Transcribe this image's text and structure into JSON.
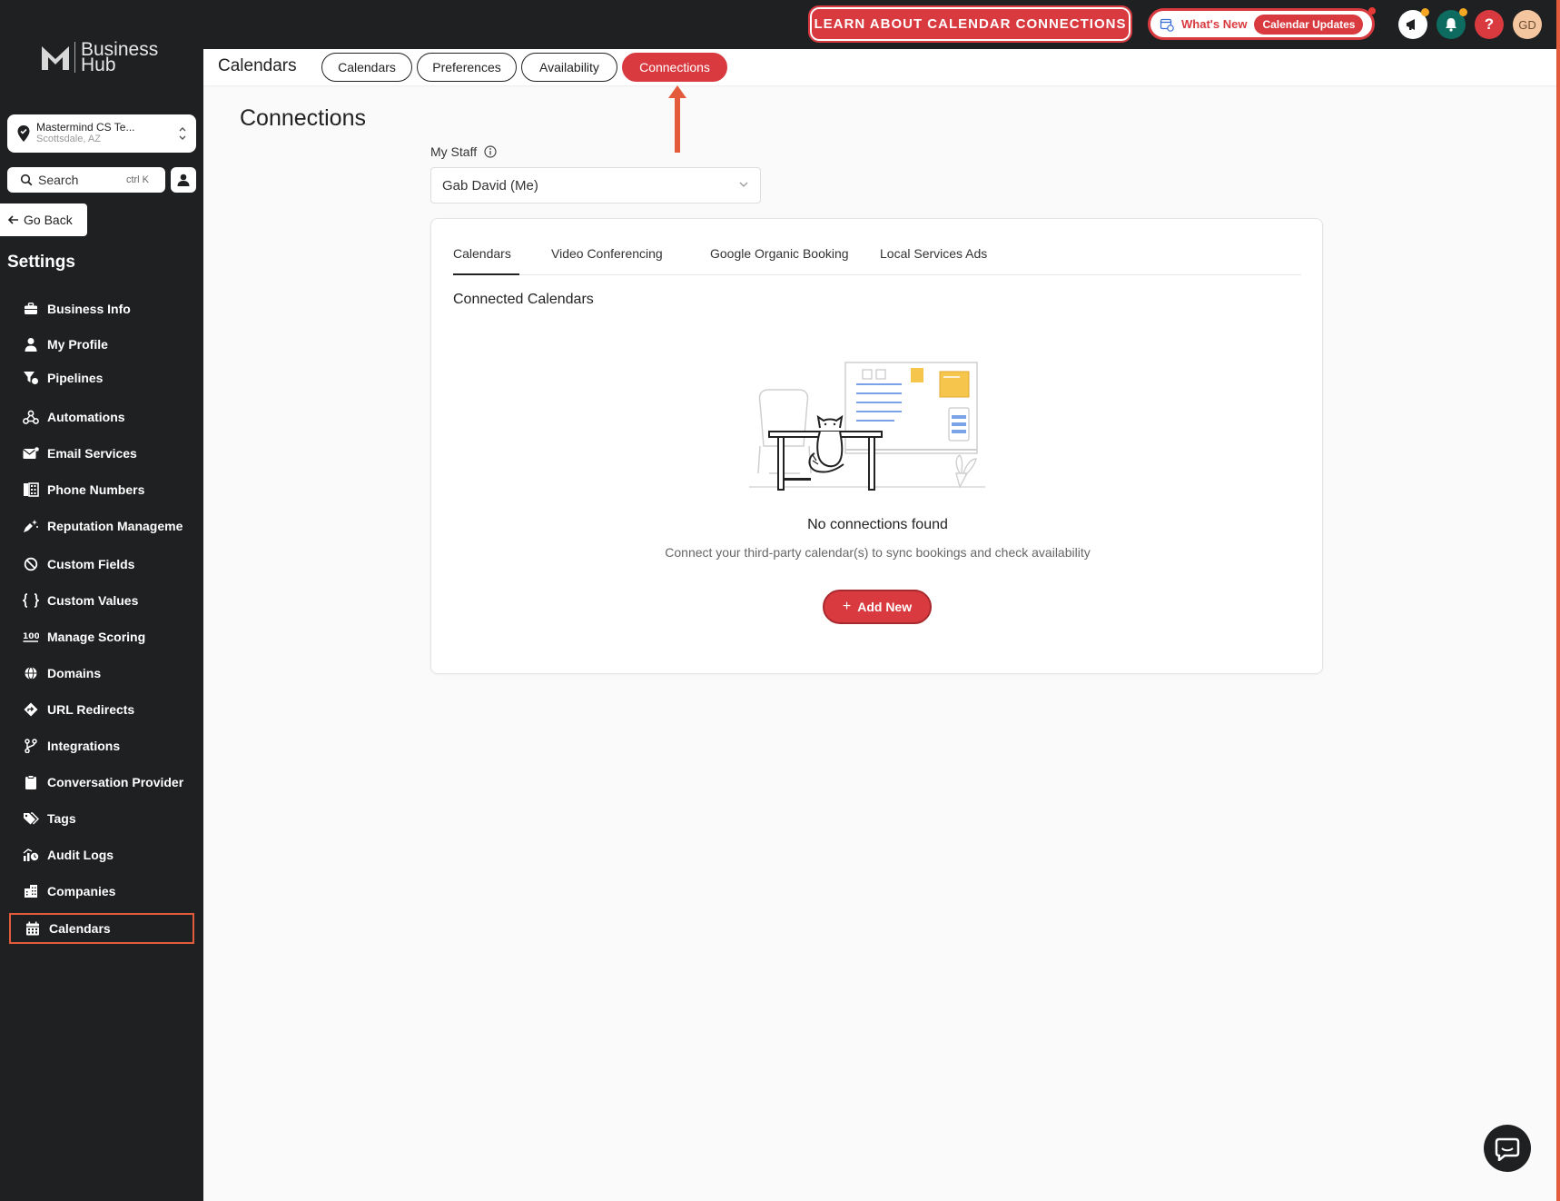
{
  "topbar": {
    "learn_button": "LEARN ABOUT CALENDAR CONNECTIONS",
    "whats_new_label": "What's New",
    "calendar_updates_label": "Calendar Updates",
    "avatar_initials": "GD",
    "help_label": "?"
  },
  "sidebar": {
    "logo_line1": "Business",
    "logo_line2": "Hub",
    "location_name": "Mastermind CS Te...",
    "location_sub": "Scottsdale, AZ",
    "search_label": "Search",
    "search_shortcut": "ctrl K",
    "go_back": "Go Back",
    "settings_title": "Settings",
    "items": [
      {
        "label": "Business Info",
        "icon": "briefcase-icon"
      },
      {
        "label": "My Profile",
        "icon": "user-icon"
      },
      {
        "label": "Pipelines",
        "icon": "funnel-icon"
      },
      {
        "label": "Automations",
        "icon": "automation-icon"
      },
      {
        "label": "Email Services",
        "icon": "email-icon"
      },
      {
        "label": "Phone Numbers",
        "icon": "phone-book-icon"
      },
      {
        "label": "Reputation Manageme",
        "icon": "star-icon"
      },
      {
        "label": "Custom Fields",
        "icon": "tag-icon"
      },
      {
        "label": "Custom Values",
        "icon": "braces-icon"
      },
      {
        "label": "Manage Scoring",
        "icon": "score-icon"
      },
      {
        "label": "Domains",
        "icon": "globe-icon"
      },
      {
        "label": "URL Redirects",
        "icon": "redirect-icon"
      },
      {
        "label": "Integrations",
        "icon": "branch-icon"
      },
      {
        "label": "Conversation Provider",
        "icon": "clipboard-icon"
      },
      {
        "label": "Tags",
        "icon": "tags-icon"
      },
      {
        "label": "Audit Logs",
        "icon": "audit-icon"
      },
      {
        "label": "Companies",
        "icon": "building-icon"
      },
      {
        "label": "Calendars",
        "icon": "calendar-icon",
        "active": true
      }
    ]
  },
  "subheader": {
    "title": "Calendars",
    "pills": [
      {
        "label": "Calendars"
      },
      {
        "label": "Preferences"
      },
      {
        "label": "Availability"
      },
      {
        "label": "Connections",
        "active": true
      }
    ]
  },
  "main": {
    "title": "Connections",
    "staff_label": "My Staff",
    "staff_value": "Gab David (Me)",
    "tabs": [
      {
        "label": "Calendars",
        "active": true
      },
      {
        "label": "Video Conferencing"
      },
      {
        "label": "Google Organic Booking"
      },
      {
        "label": "Local Services Ads"
      }
    ],
    "section_title": "Connected Calendars",
    "empty_title": "No connections found",
    "empty_desc": "Connect your third-party calendar(s) to sync bookings and check availability",
    "add_button": "Add New",
    "add_icon": "+"
  },
  "colors": {
    "brand_red": "#d93a3f",
    "sidebar_bg": "#1f2022",
    "highlight_border": "#e35b3a"
  }
}
